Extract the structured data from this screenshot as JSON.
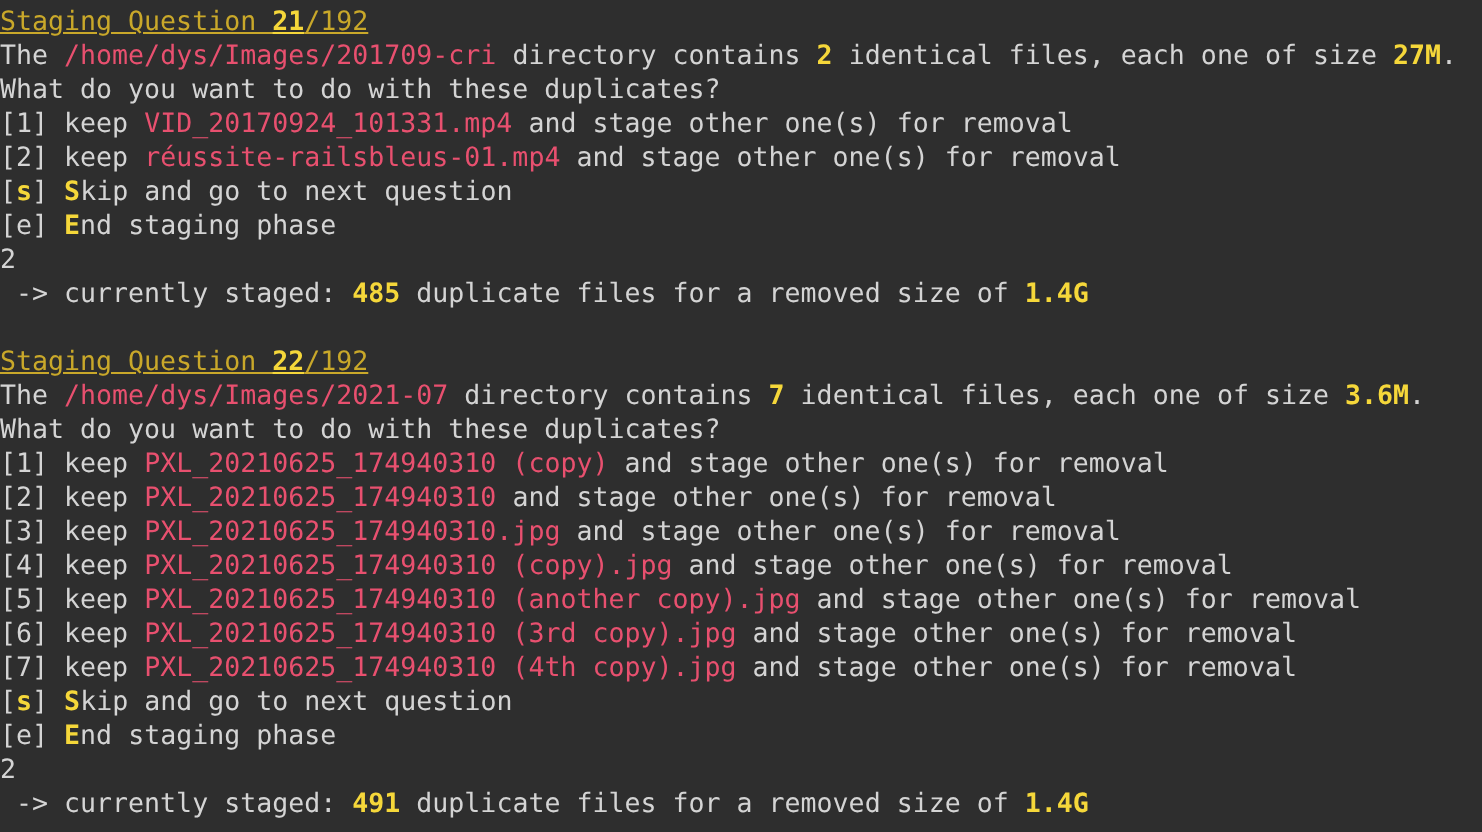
{
  "terminal": {
    "blocks": [
      {
        "lines": [
          [
            {
              "kind": "title",
              "text": "Staging Question "
            },
            {
              "kind": "title_num",
              "text": "21"
            },
            {
              "kind": "title",
              "text": "/192"
            }
          ],
          [
            {
              "kind": "plain",
              "text": "The "
            },
            {
              "kind": "path",
              "text": "/home/dys/Images/201709-cri"
            },
            {
              "kind": "plain",
              "text": " directory contains "
            },
            {
              "kind": "num",
              "text": "2"
            },
            {
              "kind": "plain",
              "text": " identical files, each one of size "
            },
            {
              "kind": "num",
              "text": "27M"
            },
            {
              "kind": "plain",
              "text": "."
            }
          ],
          [
            {
              "kind": "plain",
              "text": "What do you want to do with these duplicates?"
            }
          ],
          [
            {
              "kind": "plain",
              "text": "[1] keep "
            },
            {
              "kind": "path",
              "text": "VID_20170924_101331.mp4"
            },
            {
              "kind": "plain",
              "text": " and stage other one(s) for removal"
            }
          ],
          [
            {
              "kind": "plain",
              "text": "[2] keep "
            },
            {
              "kind": "path",
              "text": "réussite-railsbleus-01.mp4"
            },
            {
              "kind": "plain",
              "text": " and stage other one(s) for removal"
            }
          ],
          [
            {
              "kind": "plain",
              "text": "["
            },
            {
              "kind": "key",
              "text": "s"
            },
            {
              "kind": "plain",
              "text": "] "
            },
            {
              "kind": "key",
              "text": "S"
            },
            {
              "kind": "plain",
              "text": "kip and go to next question"
            }
          ],
          [
            {
              "kind": "plain",
              "text": "[e] "
            },
            {
              "kind": "key",
              "text": "E"
            },
            {
              "kind": "plain",
              "text": "nd staging phase"
            }
          ],
          [
            {
              "kind": "plain",
              "text": "2"
            }
          ],
          [
            {
              "kind": "plain",
              "text": " -> currently staged: "
            },
            {
              "kind": "num",
              "text": "485"
            },
            {
              "kind": "plain",
              "text": " duplicate files for a removed size of "
            },
            {
              "kind": "num",
              "text": "1.4G"
            }
          ]
        ]
      },
      {
        "lines": [
          [
            {
              "kind": "title",
              "text": "Staging Question "
            },
            {
              "kind": "title_num",
              "text": "22"
            },
            {
              "kind": "title",
              "text": "/192"
            }
          ],
          [
            {
              "kind": "plain",
              "text": "The "
            },
            {
              "kind": "path",
              "text": "/home/dys/Images/2021-07"
            },
            {
              "kind": "plain",
              "text": " directory contains "
            },
            {
              "kind": "num",
              "text": "7"
            },
            {
              "kind": "plain",
              "text": " identical files, each one of size "
            },
            {
              "kind": "num",
              "text": "3.6M"
            },
            {
              "kind": "plain",
              "text": "."
            }
          ],
          [
            {
              "kind": "plain",
              "text": "What do you want to do with these duplicates?"
            }
          ],
          [
            {
              "kind": "plain",
              "text": "[1] keep "
            },
            {
              "kind": "path",
              "text": "PXL_20210625_174940310 (copy)"
            },
            {
              "kind": "plain",
              "text": " and stage other one(s) for removal"
            }
          ],
          [
            {
              "kind": "plain",
              "text": "[2] keep "
            },
            {
              "kind": "path",
              "text": "PXL_20210625_174940310"
            },
            {
              "kind": "plain",
              "text": " and stage other one(s) for removal"
            }
          ],
          [
            {
              "kind": "plain",
              "text": "[3] keep "
            },
            {
              "kind": "path",
              "text": "PXL_20210625_174940310.jpg"
            },
            {
              "kind": "plain",
              "text": " and stage other one(s) for removal"
            }
          ],
          [
            {
              "kind": "plain",
              "text": "[4] keep "
            },
            {
              "kind": "path",
              "text": "PXL_20210625_174940310 (copy).jpg"
            },
            {
              "kind": "plain",
              "text": " and stage other one(s) for removal"
            }
          ],
          [
            {
              "kind": "plain",
              "text": "[5] keep "
            },
            {
              "kind": "path",
              "text": "PXL_20210625_174940310 (another copy).jpg"
            },
            {
              "kind": "plain",
              "text": " and stage other one(s) for removal"
            }
          ],
          [
            {
              "kind": "plain",
              "text": "[6] keep "
            },
            {
              "kind": "path",
              "text": "PXL_20210625_174940310 (3rd copy).jpg"
            },
            {
              "kind": "plain",
              "text": " and stage other one(s) for removal"
            }
          ],
          [
            {
              "kind": "plain",
              "text": "[7] keep "
            },
            {
              "kind": "path",
              "text": "PXL_20210625_174940310 (4th copy).jpg"
            },
            {
              "kind": "plain",
              "text": " and stage other one(s) for removal"
            }
          ],
          [
            {
              "kind": "plain",
              "text": "["
            },
            {
              "kind": "key",
              "text": "s"
            },
            {
              "kind": "plain",
              "text": "] "
            },
            {
              "kind": "key",
              "text": "S"
            },
            {
              "kind": "plain",
              "text": "kip and go to next question"
            }
          ],
          [
            {
              "kind": "plain",
              "text": "[e] "
            },
            {
              "kind": "key",
              "text": "E"
            },
            {
              "kind": "plain",
              "text": "nd staging phase"
            }
          ],
          [
            {
              "kind": "plain",
              "text": "2"
            }
          ],
          [
            {
              "kind": "plain",
              "text": " -> currently staged: "
            },
            {
              "kind": "num",
              "text": "491"
            },
            {
              "kind": "plain",
              "text": " duplicate files for a removed size of "
            },
            {
              "kind": "num",
              "text": "1.4G"
            }
          ]
        ]
      }
    ]
  }
}
